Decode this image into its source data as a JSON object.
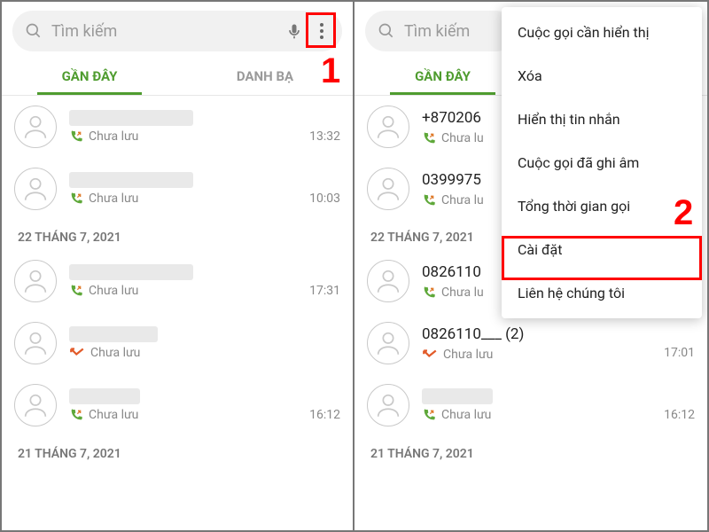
{
  "search": {
    "placeholder": "Tìm kiếm"
  },
  "tabs": {
    "recent": "GẦN ĐÂY",
    "contacts": "DANH BẠ"
  },
  "annotations": {
    "step1": "1",
    "step2": "2"
  },
  "left": {
    "calls": [
      {
        "name": "",
        "sub": "Chưa lưu",
        "time": "13:32",
        "type": "out"
      },
      {
        "name": "",
        "sub": "Chưa lưu",
        "time": "10:03",
        "type": "out"
      }
    ],
    "date1": "22 THÁNG 7, 2021",
    "calls2": [
      {
        "name": "",
        "sub": "Chưa lưu",
        "time": "17:31",
        "type": "out"
      },
      {
        "name": "",
        "sub": "Chưa lưu",
        "time": "",
        "type": "missed"
      },
      {
        "name": "",
        "sub": "Chưa lưu",
        "time": "16:12",
        "type": "out"
      }
    ],
    "date2": "21 THÁNG 7, 2021"
  },
  "right": {
    "calls": [
      {
        "name": "+870206",
        "sub": "Chưa lu",
        "time": "",
        "type": "out"
      },
      {
        "name": "0399975",
        "sub": "Chưa lu",
        "time": "",
        "type": "out"
      }
    ],
    "date1": "22 THÁNG 7, 2021",
    "calls2": [
      {
        "name": "0826110",
        "sub": "Chưa lu",
        "time": "",
        "type": "out"
      },
      {
        "name": "0826110___ (2)",
        "sub": "Chưa lưu",
        "time": "17:01",
        "type": "missed"
      },
      {
        "name": "",
        "sub": "Chưa lưu",
        "time": "16:12",
        "type": "out"
      }
    ],
    "date2": "21 THÁNG 7, 2021"
  },
  "menu": {
    "items": [
      "Cuộc gọi cần hiển thị",
      "Xóa",
      "Hiển thị tin nhắn",
      "Cuộc gọi đã ghi âm",
      "Tổng thời gian gọi",
      "Cài đặt",
      "Liên hệ chúng tôi"
    ]
  }
}
